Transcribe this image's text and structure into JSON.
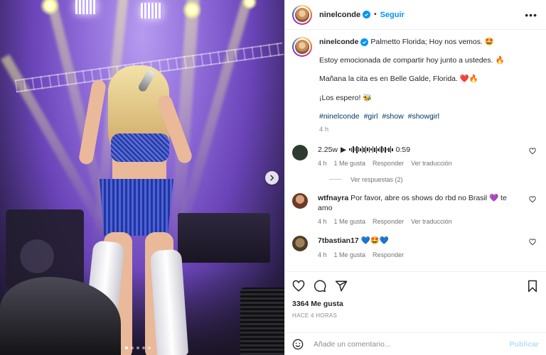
{
  "post": {
    "username": "ninelconde",
    "follow_label": "Seguir",
    "separator": "•",
    "more_label": "•••",
    "caption": {
      "first_line": "Palmetto Florida; Hoy nos vemos. 🤩",
      "lines": [
        "Estoy emocionada de compartir hoy junto a ustedes. 🔥",
        "Mañana la cita es en Belle Galde, Florida. ❤️🔥",
        "¡Los espero! 🐝"
      ],
      "hashtags": [
        "#ninelconde",
        "#girl",
        "#show",
        "#showgirl"
      ],
      "time": "4 h"
    },
    "photo": {
      "carousel_dots": 5,
      "active_dot": 0
    }
  },
  "comments": [
    {
      "username": "2.25w",
      "audio_duration": "0:59",
      "time": "4 h",
      "likes": "1 Me gusta",
      "reply": "Responder",
      "translate": "Ver traducción",
      "avatar_color": "#2f3b2f",
      "view_replies": "Ver respuestas (2)"
    },
    {
      "username": "wtfnayra",
      "text": "Por favor, abre os shows do rbd no Brasil 💜 te amo",
      "time": "4 h",
      "likes": "1 Me gusta",
      "reply": "Responder",
      "translate": "Ver traducción",
      "avatar_color": "#9a5a3e"
    },
    {
      "username": "7tbastian17",
      "text": "💙🤩💙",
      "time": "4 h",
      "likes": "1 Me gusta",
      "reply": "Responder",
      "avatar_color": "#6b5a3a"
    }
  ],
  "footer": {
    "likes_count": "3364 Me gusta",
    "posted_ago": "HACE 4 HORAS",
    "comment_placeholder": "Añade un comentario...",
    "publish_label": "Publicar"
  },
  "colors": {
    "accent": "#0095f6",
    "hashtag": "#00376b",
    "muted": "#8e8e8e",
    "publish_disabled": "#b2dffc"
  }
}
